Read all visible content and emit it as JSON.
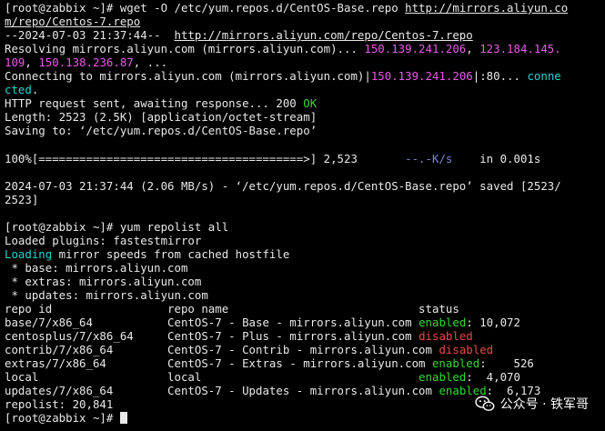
{
  "colors": {
    "default": "#e8e8e8",
    "magenta": "#e85ae8",
    "cyan": "#22d3d3",
    "green": "#33d833",
    "red": "#e84a4a",
    "dim_blue": "#7a86d6"
  },
  "watermark": {
    "icon": "wechat-icon",
    "text": "公众号 · 铁军哥"
  },
  "lines": [
    [
      {
        "t": "[root@zabbix ~]# wget -O /etc/yum.repos.d/CentOS-Base.repo "
      },
      {
        "t": "http://mirrors.aliyun.co",
        "u": true
      }
    ],
    [
      {
        "t": "m/repo/Centos-7.repo",
        "u": true
      }
    ],
    [
      {
        "t": "--2024-07-03 21:37:44--  "
      },
      {
        "t": "http://mirrors.aliyun.com/repo/Centos-7.repo",
        "u": true
      }
    ],
    [
      {
        "t": "Resolving mirrors.aliyun.com (mirrors.aliyun.com)... "
      },
      {
        "t": "150.139.241.206",
        "c": "magenta"
      },
      {
        "t": ", "
      },
      {
        "t": "123.184.145.",
        "c": "magenta"
      }
    ],
    [
      {
        "t": "109",
        "c": "magenta"
      },
      {
        "t": ", "
      },
      {
        "t": "150.138.236.87",
        "c": "magenta"
      },
      {
        "t": ", ..."
      }
    ],
    [
      {
        "t": "Connecting to mirrors.aliyun.com (mirrors.aliyun.com)|"
      },
      {
        "t": "150.139.241.206",
        "c": "magenta"
      },
      {
        "t": "|:80... "
      },
      {
        "t": "conne",
        "c": "cyan"
      }
    ],
    [
      {
        "t": "cted",
        "c": "cyan"
      },
      {
        "t": "."
      }
    ],
    [
      {
        "t": "HTTP request sent, awaiting response... 200 "
      },
      {
        "t": "OK",
        "c": "green"
      }
    ],
    [
      {
        "t": "Length: 2523 (2.5K) [application/octet-stream]"
      }
    ],
    [
      {
        "t": "Saving to: ‘/etc/yum.repos.d/CentOS-Base.repo’"
      }
    ],
    [
      {
        "t": ""
      }
    ],
    [
      {
        "t": "100%[=======================================>] 2,523       "
      },
      {
        "t": "--.-K/s",
        "c": "dim_blue"
      },
      {
        "t": "    in 0.001s"
      }
    ],
    [
      {
        "t": ""
      }
    ],
    [
      {
        "t": "2024-07-03 21:37:44 (2.06 MB/s) - ‘/etc/yum.repos.d/CentOS-Base.repo’ saved [2523/"
      }
    ],
    [
      {
        "t": "2523]"
      }
    ],
    [
      {
        "t": ""
      }
    ],
    [
      {
        "t": "[root@zabbix ~]# yum repolist all"
      }
    ],
    [
      {
        "t": "Loaded plugins: fastestmirror"
      }
    ],
    [
      {
        "t": "Loading",
        "c": "cyan"
      },
      {
        "t": " mirror speeds from cached hostfile"
      }
    ],
    [
      {
        "t": " * base: mirrors.aliyun.com"
      }
    ],
    [
      {
        "t": " * extras: mirrors.aliyun.com"
      }
    ],
    [
      {
        "t": " * updates: mirrors.aliyun.com"
      }
    ],
    [
      {
        "t": "repo id                 repo name                            status"
      }
    ],
    [
      {
        "t": "base/7/x86_64           CentOS-7 - Base - mirrors.aliyun.com "
      },
      {
        "t": "enabled",
        "c": "green"
      },
      {
        "t": ": 10,072"
      }
    ],
    [
      {
        "t": "centosplus/7/x86_64     CentOS-7 - Plus - mirrors.aliyun.com "
      },
      {
        "t": "disabled",
        "c": "red"
      }
    ],
    [
      {
        "t": "contrib/7/x86_64        CentOS-7 - Contrib - mirrors.aliyun.com "
      },
      {
        "t": "disabled",
        "c": "red"
      }
    ],
    [
      {
        "t": "extras/7/x86_64         CentOS-7 - Extras - mirrors.aliyun.com "
      },
      {
        "t": "enabled",
        "c": "green"
      },
      {
        "t": ":    526"
      }
    ],
    [
      {
        "t": "local                   local                                "
      },
      {
        "t": "enabled",
        "c": "green"
      },
      {
        "t": ":  4,070"
      }
    ],
    [
      {
        "t": "updates/7/x86_64        CentOS-7 - Updates - mirrors.aliyun.com "
      },
      {
        "t": "enabled",
        "c": "green"
      },
      {
        "t": ":  6,173"
      }
    ],
    [
      {
        "t": "repolist: 20,841"
      }
    ],
    [
      {
        "t": "[root@zabbix ~]# "
      }
    ]
  ]
}
